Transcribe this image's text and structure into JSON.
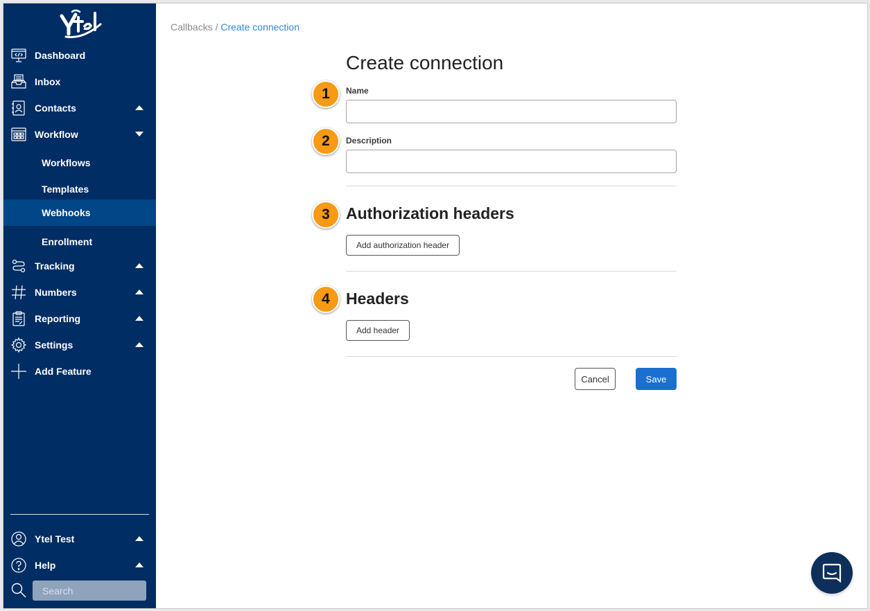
{
  "sidebar": {
    "logo_text": "Ytel",
    "items": [
      {
        "label": "Dashboard",
        "icon": "dashboard-icon"
      },
      {
        "label": "Inbox",
        "icon": "inbox-icon"
      },
      {
        "label": "Contacts",
        "icon": "contacts-icon",
        "caret": "up"
      },
      {
        "label": "Workflow",
        "icon": "workflow-icon",
        "caret": "down"
      },
      {
        "label": "Tracking",
        "icon": "tracking-icon",
        "caret": "up"
      },
      {
        "label": "Numbers",
        "icon": "hash-icon",
        "caret": "up"
      },
      {
        "label": "Reporting",
        "icon": "clipboard-icon",
        "caret": "up"
      },
      {
        "label": "Settings",
        "icon": "gear-icon",
        "caret": "up"
      },
      {
        "label": "Add Feature",
        "icon": "plus-icon"
      }
    ],
    "workflow_sub": [
      {
        "label": "Workflows",
        "active": false
      },
      {
        "label": "Templates",
        "active": false
      },
      {
        "label": "Webhooks",
        "active": true
      },
      {
        "label": "Enrollment",
        "active": false
      }
    ],
    "user": {
      "label": "Ytel Test",
      "icon": "user-circle-icon",
      "caret": "up"
    },
    "help": {
      "label": "Help",
      "icon": "help-circle-icon",
      "caret": "up"
    },
    "search": {
      "placeholder": "Search",
      "icon": "search-icon"
    }
  },
  "breadcrumb": {
    "parent": "Callbacks",
    "separator": "/",
    "current": "Create connection"
  },
  "form": {
    "title": "Create connection",
    "name_label": "Name",
    "name_value": "",
    "description_label": "Description",
    "description_value": "",
    "auth_headers_title": "Authorization headers",
    "add_auth_header_label": "Add authorization header",
    "headers_title": "Headers",
    "add_header_label": "Add header",
    "cancel_label": "Cancel",
    "save_label": "Save"
  },
  "callouts": [
    "1",
    "2",
    "3",
    "4"
  ],
  "colors": {
    "sidebar_bg": "#002d63",
    "sidebar_active": "#014687",
    "accent": "#1a6fd1",
    "link": "#2f88d6",
    "callout": "#f79a14"
  },
  "chat": {
    "icon": "chat-bubble-icon"
  }
}
